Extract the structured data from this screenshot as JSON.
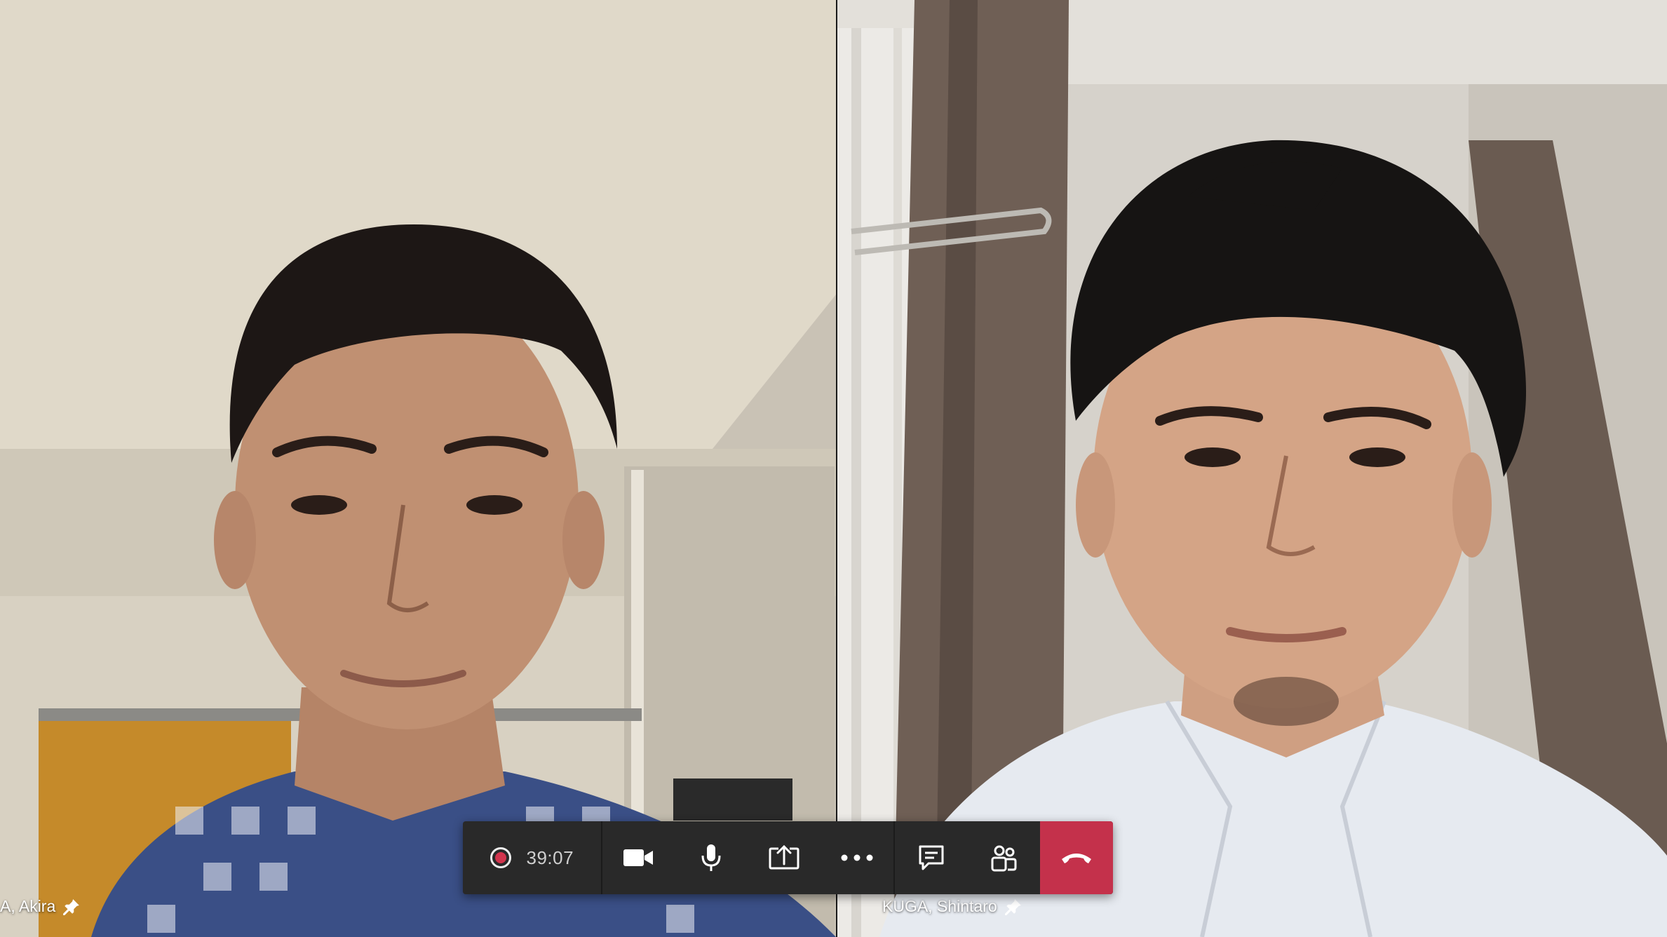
{
  "participants": [
    {
      "name": "A, Akira",
      "pinned": true
    },
    {
      "name": "KUGA, Shintaro",
      "pinned": true
    }
  ],
  "toolbar": {
    "timer": "39:07",
    "recording": true,
    "buttons": [
      {
        "id": "camera",
        "icon": "video-camera-icon"
      },
      {
        "id": "microphone",
        "icon": "microphone-icon"
      },
      {
        "id": "share",
        "icon": "share-screen-icon"
      },
      {
        "id": "more",
        "icon": "more-options-icon"
      },
      {
        "id": "chat",
        "icon": "chat-icon"
      },
      {
        "id": "participants",
        "icon": "participants-icon"
      },
      {
        "id": "hang-up",
        "icon": "hang-up-icon"
      }
    ]
  },
  "colors": {
    "toolbar_bg": "#292929",
    "hangup_red": "#c4314b",
    "record_red": "#d1344d"
  }
}
